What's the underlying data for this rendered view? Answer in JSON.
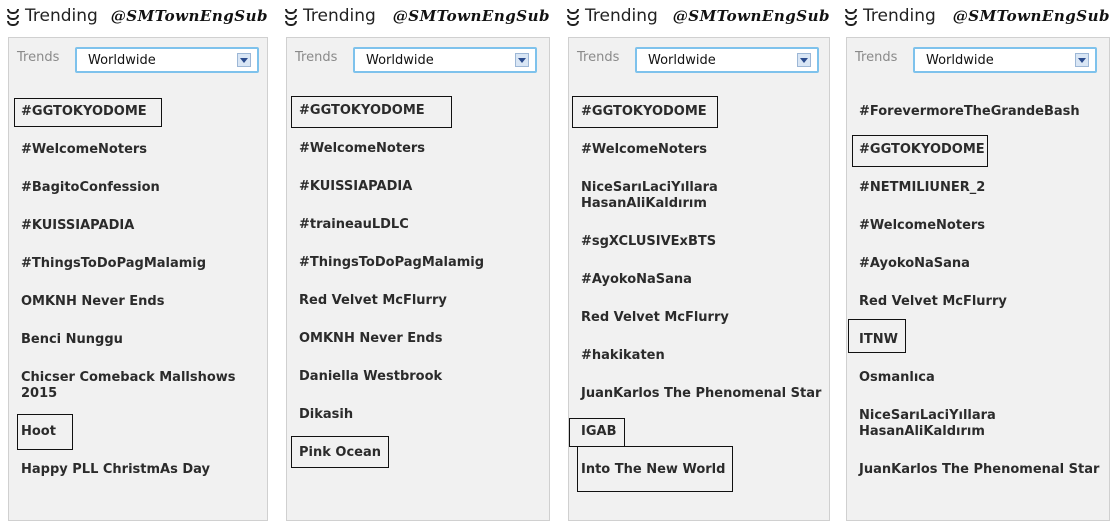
{
  "header": {
    "title": "Trending",
    "watermark": "@SMTownEngSub"
  },
  "trends_label": "Trends",
  "location": "Worldwide",
  "panels": [
    {
      "items": [
        "#GGTOKYODOME",
        "#WelcomeNoters",
        "#BagitoConfession",
        "#KUISSIAPADIA",
        "#ThingsToDoPagMalamig",
        "OMKNH Never Ends",
        "Benci Nunggu",
        "Chicser Comeback Mallshows 2015",
        "Hoot",
        "Happy PLL ChristmAs Day"
      ]
    },
    {
      "items": [
        "#GGTOKYODOME",
        "#WelcomeNoters",
        "#KUISSIAPADIA",
        "#traineauLDLC",
        "#ThingsToDoPagMalamig",
        "Red Velvet McFlurry",
        "OMKNH Never Ends",
        "Daniella Westbrook",
        "Dikasih",
        "Pink Ocean"
      ]
    },
    {
      "items": [
        "#GGTOKYODOME",
        "#WelcomeNoters",
        "NiceSarıLaciYıllara HasanAliKaldırım",
        "#sgXCLUSIVExBTS",
        "#AyokoNaSana",
        "Red Velvet McFlurry",
        "#hakikaten",
        "JuanKarlos The Phenomenal Star",
        "IGAB",
        "Into The New World"
      ]
    },
    {
      "items": [
        "#ForevermoreTheGrandeBash",
        "#GGTOKYODOME",
        "#NETMILIUNER_2",
        "#WelcomeNoters",
        "#AyokoNaSana",
        "Red Velvet McFlurry",
        "ITNW",
        "Osmanlıca",
        "NiceSarıLaciYıllara HasanAliKaldırım",
        "JuanKarlos The Phenomenal Star"
      ]
    }
  ]
}
